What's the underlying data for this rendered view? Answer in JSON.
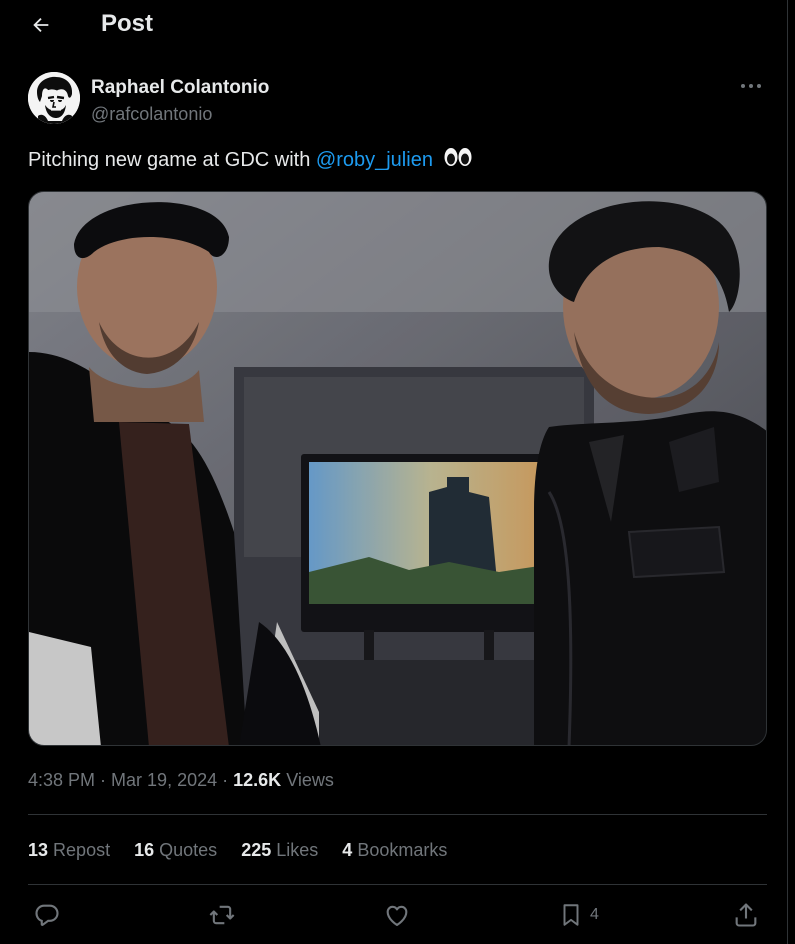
{
  "header": {
    "title": "Post"
  },
  "author": {
    "name": "Raphael Colantonio",
    "handle": "@rafcolantonio"
  },
  "tweet": {
    "text_before": "Pitching new game at GDC with ",
    "mention": "@roby_julien",
    "emoji": "👀"
  },
  "meta": {
    "time": "4:38 PM",
    "sep1": " · ",
    "date": "Mar 19, 2024",
    "sep2": " · ",
    "views_count": "12.6K",
    "views_label": "Views"
  },
  "stats": [
    {
      "count": "13",
      "label": "Repost"
    },
    {
      "count": "16",
      "label": "Quotes"
    },
    {
      "count": "225",
      "label": "Likes"
    },
    {
      "count": "4",
      "label": "Bookmarks"
    }
  ],
  "actions": {
    "reply": {
      "icon": "reply-icon"
    },
    "repost": {
      "icon": "repost-icon"
    },
    "like": {
      "icon": "heart-icon"
    },
    "bookmark": {
      "icon": "bookmark-icon",
      "count": "4"
    },
    "share": {
      "icon": "share-icon"
    }
  },
  "colors": {
    "background": "#000000",
    "text": "#e7e9ea",
    "muted": "#71767b",
    "accent": "#1d9bf0",
    "border": "#2f3336"
  }
}
